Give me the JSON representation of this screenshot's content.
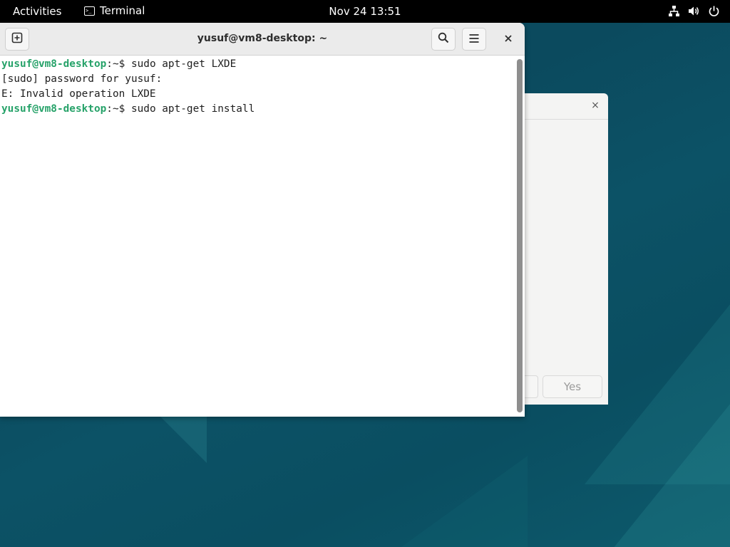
{
  "top_bar": {
    "activities_label": "Activities",
    "app_name": "Terminal",
    "clock": "Nov 24  13:51",
    "tray_icons": [
      "network-icon",
      "volume-icon",
      "power-icon"
    ]
  },
  "terminal": {
    "title": "yusuf@vm8-desktop: ~",
    "header_buttons": [
      "new-tab-icon",
      "search-icon",
      "hamburger-menu-icon",
      "close-icon"
    ],
    "lines": [
      {
        "user": "yusuf@vm8-desktop",
        "path": ":~$ ",
        "text": "sudo apt-get LXDE"
      },
      {
        "text": "[sudo] password for yusuf:"
      },
      {
        "text": "E: Invalid operation LXDE"
      },
      {
        "user": "yusuf@vm8-desktop",
        "path": ":~$ ",
        "text": "sudo apt-get install"
      }
    ]
  },
  "background_dialog": {
    "close_label": "×",
    "yes_label": "Yes"
  },
  "colors": {
    "prompt_user": "#26a269",
    "top_bar": "#000000",
    "desktop": "#0b4a5e"
  }
}
